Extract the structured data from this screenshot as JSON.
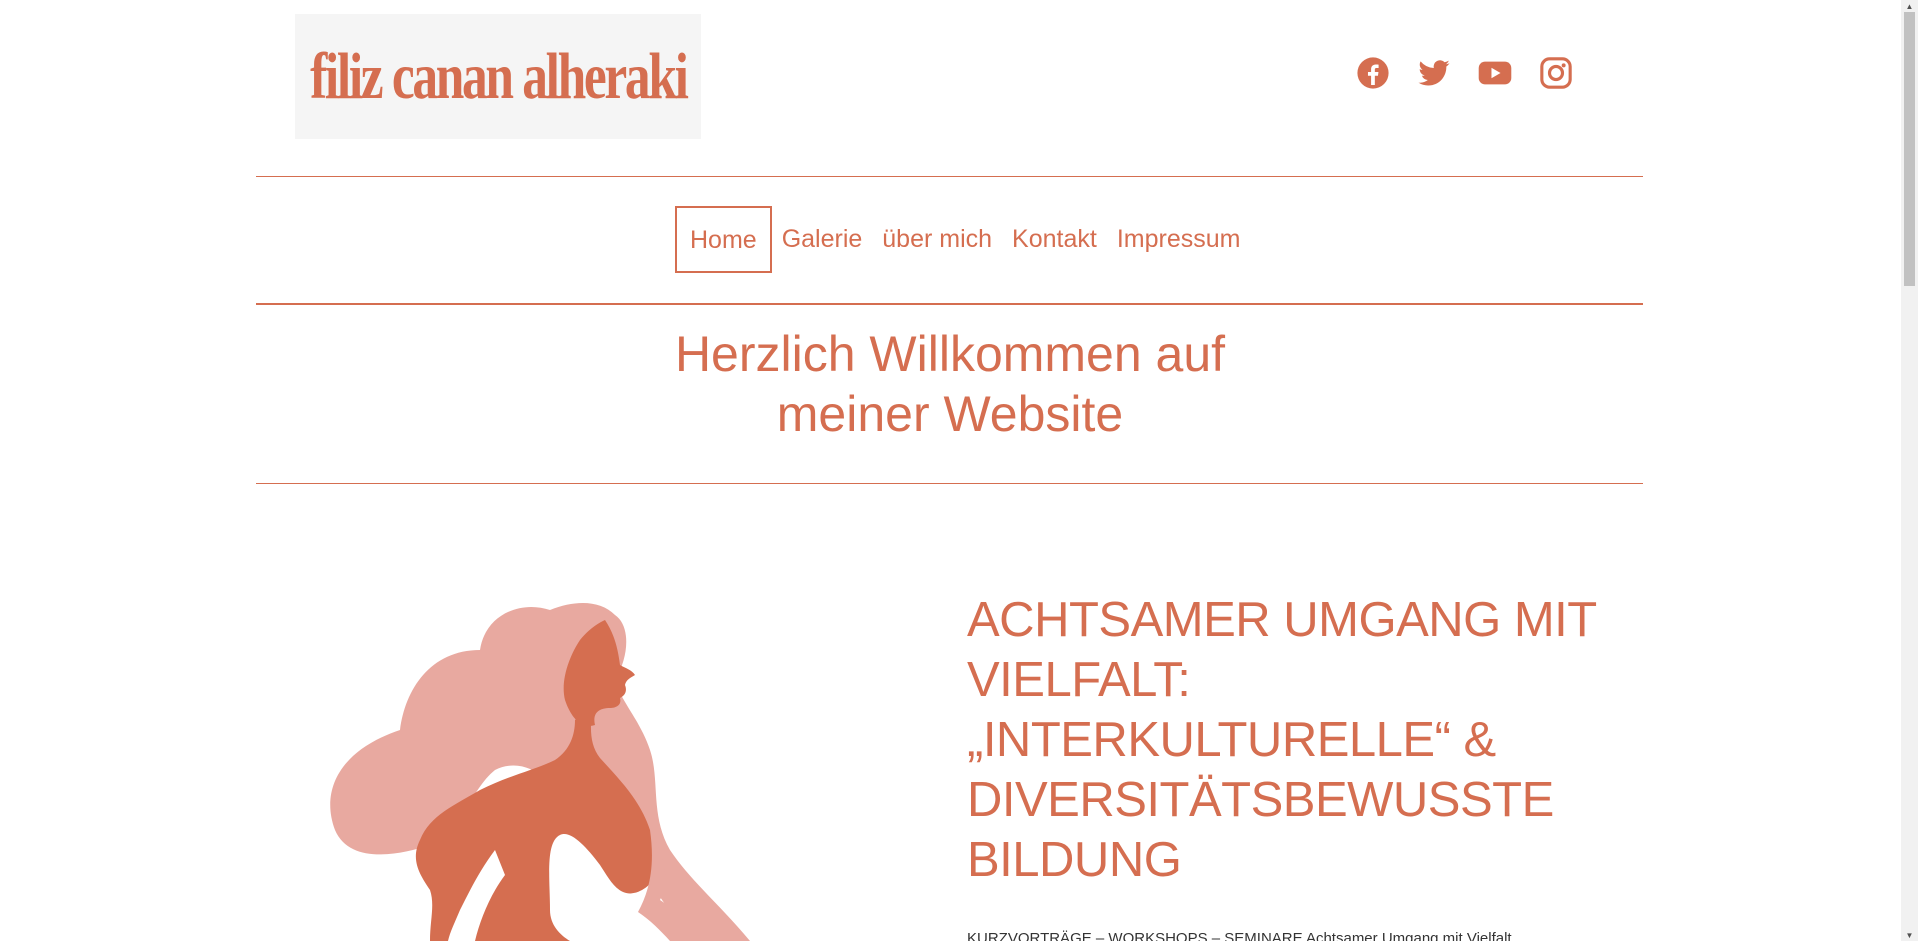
{
  "header": {
    "logo_text": "filiz canan alheraki",
    "social": [
      {
        "name": "facebook-icon"
      },
      {
        "name": "twitter-icon"
      },
      {
        "name": "youtube-icon"
      },
      {
        "name": "instagram-icon"
      }
    ]
  },
  "nav": {
    "items": [
      {
        "label": "Home",
        "active": true
      },
      {
        "label": "Galerie"
      },
      {
        "label": "über mich"
      },
      {
        "label": "Kontakt"
      },
      {
        "label": "Impressum"
      }
    ]
  },
  "welcome": {
    "line1": "Herzlich Willkommen auf",
    "line2": "meiner Website"
  },
  "main": {
    "heading_lines": [
      "ACHTSAMER UMGANG MIT",
      "VIELFALT:",
      "„INTERKULTURELLE“ &",
      "DIVERSITÄTSBEWUSSTE",
      "BILDUNG"
    ],
    "subline": "KURZVORTRÄGE – WORKSHOPS – SEMINARE Achtsamer Umgang mit Vielfalt"
  },
  "colors": {
    "accent": "#d56e50",
    "hair": "#e8a9a0",
    "logo_bg": "#f5f5f5"
  }
}
